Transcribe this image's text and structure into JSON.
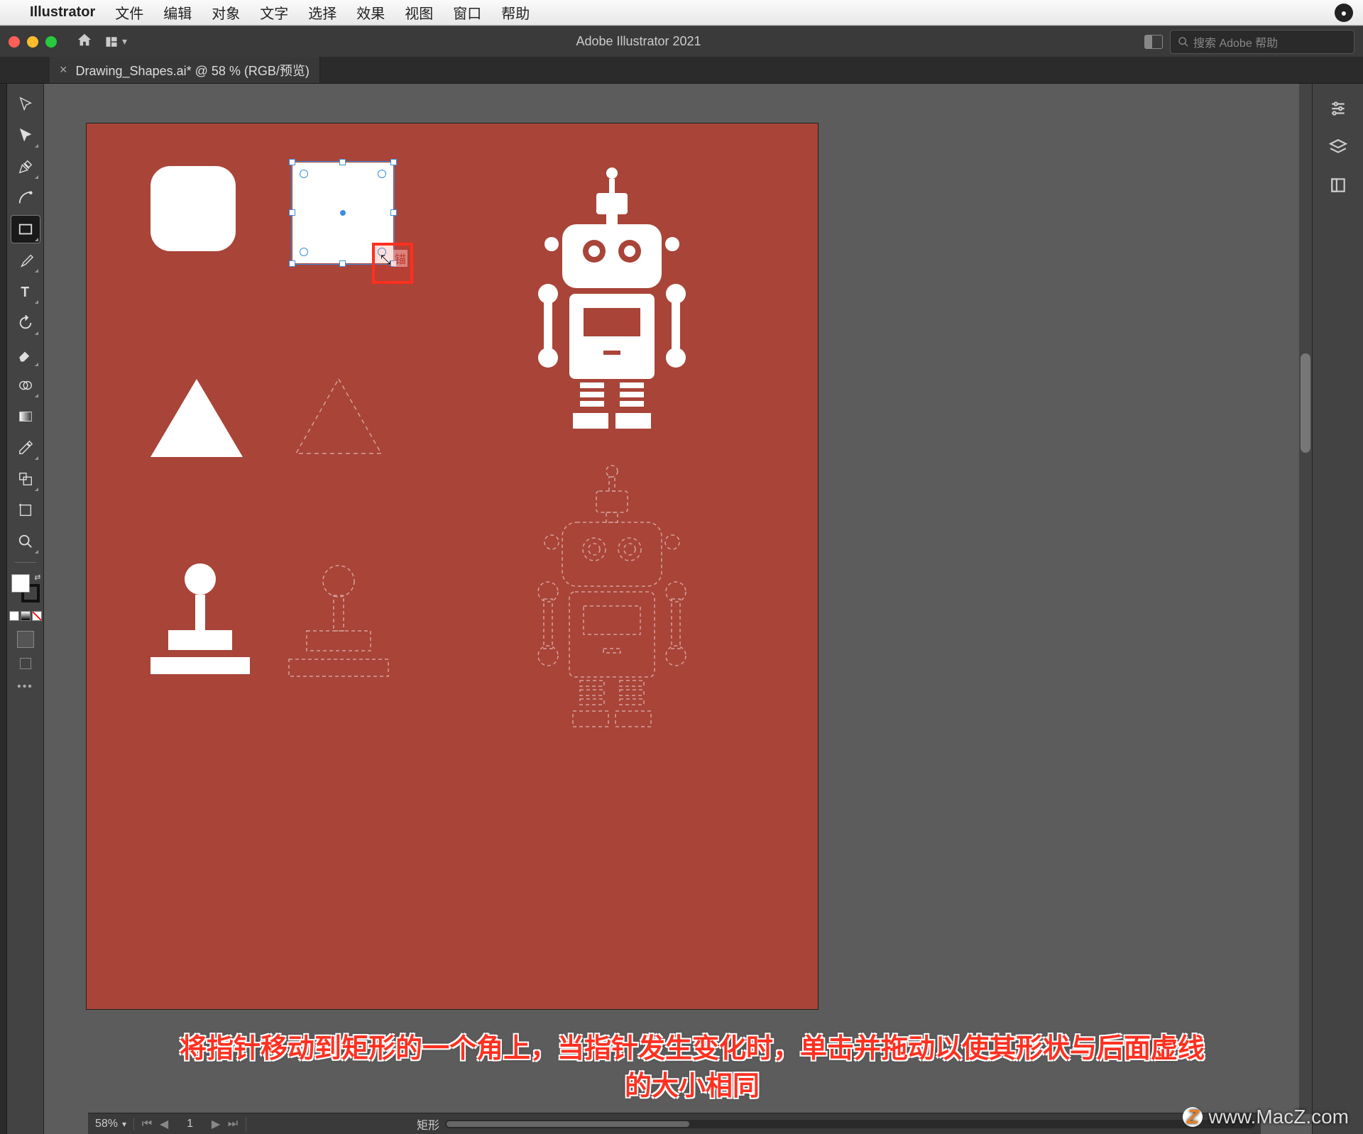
{
  "menubar": {
    "app_name": "Illustrator",
    "items": [
      "文件",
      "编辑",
      "对象",
      "文字",
      "选择",
      "效果",
      "视图",
      "窗口",
      "帮助"
    ]
  },
  "titlebar": {
    "title": "Adobe Illustrator 2021",
    "search_placeholder": "搜索 Adobe 帮助"
  },
  "tab": {
    "label": "Drawing_Shapes.ai* @ 58 % (RGB/预览)"
  },
  "cursor_hint": "锚",
  "statusbar": {
    "zoom": "58%",
    "artboard_num": "1",
    "tool_name": "矩形"
  },
  "instruction": {
    "line1": "将指针移动到矩形的一个角上，当指针发生变化时，单击并拖动以使其形状与后面虚线",
    "line2": "的大小相同"
  },
  "watermark": "www.MacZ.com",
  "colors": {
    "artboard_bg": "#a94438",
    "selection": "#3b8ee0",
    "highlight": "#ff3020"
  }
}
